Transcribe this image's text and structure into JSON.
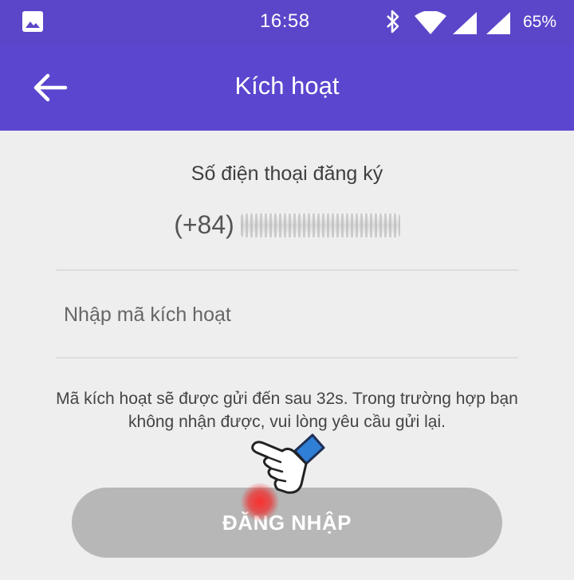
{
  "status_bar": {
    "time": "16:58",
    "battery": "65%",
    "icons": [
      "gallery-icon",
      "bluetooth-icon",
      "wifi-icon",
      "signal-icon",
      "signal-icon"
    ]
  },
  "app_bar": {
    "title": "Kích hoạt",
    "back_icon": "arrow-left-icon"
  },
  "phone": {
    "label": "Số điện thoại đăng ký",
    "prefix": "(+84)"
  },
  "activation_code": {
    "value": "",
    "placeholder": "Nhập mã kích hoạt"
  },
  "notice": "Mã kích hoạt sẽ được gửi đến sau 32s. Trong trường hợp bạn không nhận được, vui lòng yêu cầu gửi lại.",
  "login_button": {
    "label": "ĐĂNG NHẬP"
  },
  "colors": {
    "primary": "#5b46cf",
    "background": "#eeeeee",
    "button_disabled": "#b7b7b7"
  }
}
